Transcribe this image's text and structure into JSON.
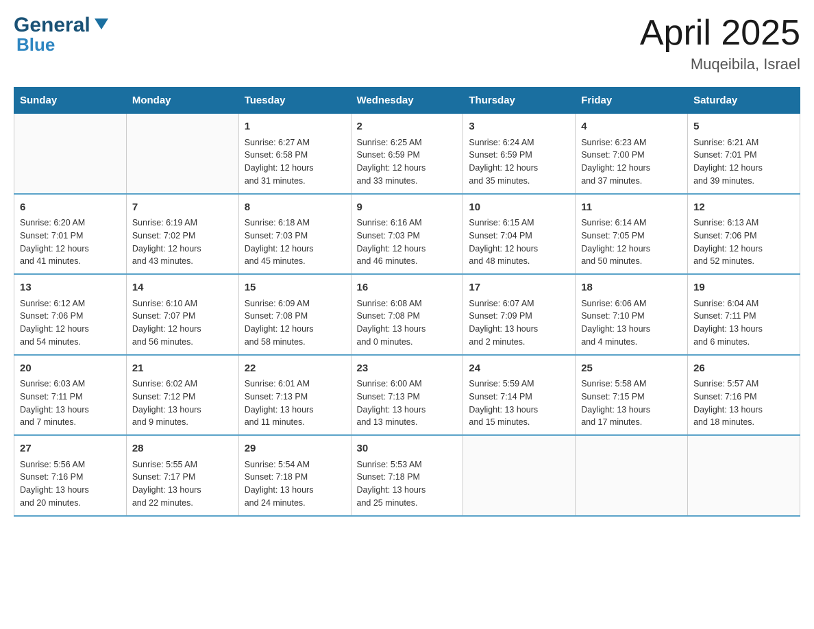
{
  "header": {
    "logo_main": "General",
    "logo_arrow": "▼",
    "logo_blue": "Blue",
    "title": "April 2025",
    "subtitle": "Muqeibila, Israel"
  },
  "calendar": {
    "days_of_week": [
      "Sunday",
      "Monday",
      "Tuesday",
      "Wednesday",
      "Thursday",
      "Friday",
      "Saturday"
    ],
    "weeks": [
      [
        {
          "day": "",
          "info": ""
        },
        {
          "day": "",
          "info": ""
        },
        {
          "day": "1",
          "info": "Sunrise: 6:27 AM\nSunset: 6:58 PM\nDaylight: 12 hours\nand 31 minutes."
        },
        {
          "day": "2",
          "info": "Sunrise: 6:25 AM\nSunset: 6:59 PM\nDaylight: 12 hours\nand 33 minutes."
        },
        {
          "day": "3",
          "info": "Sunrise: 6:24 AM\nSunset: 6:59 PM\nDaylight: 12 hours\nand 35 minutes."
        },
        {
          "day": "4",
          "info": "Sunrise: 6:23 AM\nSunset: 7:00 PM\nDaylight: 12 hours\nand 37 minutes."
        },
        {
          "day": "5",
          "info": "Sunrise: 6:21 AM\nSunset: 7:01 PM\nDaylight: 12 hours\nand 39 minutes."
        }
      ],
      [
        {
          "day": "6",
          "info": "Sunrise: 6:20 AM\nSunset: 7:01 PM\nDaylight: 12 hours\nand 41 minutes."
        },
        {
          "day": "7",
          "info": "Sunrise: 6:19 AM\nSunset: 7:02 PM\nDaylight: 12 hours\nand 43 minutes."
        },
        {
          "day": "8",
          "info": "Sunrise: 6:18 AM\nSunset: 7:03 PM\nDaylight: 12 hours\nand 45 minutes."
        },
        {
          "day": "9",
          "info": "Sunrise: 6:16 AM\nSunset: 7:03 PM\nDaylight: 12 hours\nand 46 minutes."
        },
        {
          "day": "10",
          "info": "Sunrise: 6:15 AM\nSunset: 7:04 PM\nDaylight: 12 hours\nand 48 minutes."
        },
        {
          "day": "11",
          "info": "Sunrise: 6:14 AM\nSunset: 7:05 PM\nDaylight: 12 hours\nand 50 minutes."
        },
        {
          "day": "12",
          "info": "Sunrise: 6:13 AM\nSunset: 7:06 PM\nDaylight: 12 hours\nand 52 minutes."
        }
      ],
      [
        {
          "day": "13",
          "info": "Sunrise: 6:12 AM\nSunset: 7:06 PM\nDaylight: 12 hours\nand 54 minutes."
        },
        {
          "day": "14",
          "info": "Sunrise: 6:10 AM\nSunset: 7:07 PM\nDaylight: 12 hours\nand 56 minutes."
        },
        {
          "day": "15",
          "info": "Sunrise: 6:09 AM\nSunset: 7:08 PM\nDaylight: 12 hours\nand 58 minutes."
        },
        {
          "day": "16",
          "info": "Sunrise: 6:08 AM\nSunset: 7:08 PM\nDaylight: 13 hours\nand 0 minutes."
        },
        {
          "day": "17",
          "info": "Sunrise: 6:07 AM\nSunset: 7:09 PM\nDaylight: 13 hours\nand 2 minutes."
        },
        {
          "day": "18",
          "info": "Sunrise: 6:06 AM\nSunset: 7:10 PM\nDaylight: 13 hours\nand 4 minutes."
        },
        {
          "day": "19",
          "info": "Sunrise: 6:04 AM\nSunset: 7:11 PM\nDaylight: 13 hours\nand 6 minutes."
        }
      ],
      [
        {
          "day": "20",
          "info": "Sunrise: 6:03 AM\nSunset: 7:11 PM\nDaylight: 13 hours\nand 7 minutes."
        },
        {
          "day": "21",
          "info": "Sunrise: 6:02 AM\nSunset: 7:12 PM\nDaylight: 13 hours\nand 9 minutes."
        },
        {
          "day": "22",
          "info": "Sunrise: 6:01 AM\nSunset: 7:13 PM\nDaylight: 13 hours\nand 11 minutes."
        },
        {
          "day": "23",
          "info": "Sunrise: 6:00 AM\nSunset: 7:13 PM\nDaylight: 13 hours\nand 13 minutes."
        },
        {
          "day": "24",
          "info": "Sunrise: 5:59 AM\nSunset: 7:14 PM\nDaylight: 13 hours\nand 15 minutes."
        },
        {
          "day": "25",
          "info": "Sunrise: 5:58 AM\nSunset: 7:15 PM\nDaylight: 13 hours\nand 17 minutes."
        },
        {
          "day": "26",
          "info": "Sunrise: 5:57 AM\nSunset: 7:16 PM\nDaylight: 13 hours\nand 18 minutes."
        }
      ],
      [
        {
          "day": "27",
          "info": "Sunrise: 5:56 AM\nSunset: 7:16 PM\nDaylight: 13 hours\nand 20 minutes."
        },
        {
          "day": "28",
          "info": "Sunrise: 5:55 AM\nSunset: 7:17 PM\nDaylight: 13 hours\nand 22 minutes."
        },
        {
          "day": "29",
          "info": "Sunrise: 5:54 AM\nSunset: 7:18 PM\nDaylight: 13 hours\nand 24 minutes."
        },
        {
          "day": "30",
          "info": "Sunrise: 5:53 AM\nSunset: 7:18 PM\nDaylight: 13 hours\nand 25 minutes."
        },
        {
          "day": "",
          "info": ""
        },
        {
          "day": "",
          "info": ""
        },
        {
          "day": "",
          "info": ""
        }
      ]
    ]
  }
}
